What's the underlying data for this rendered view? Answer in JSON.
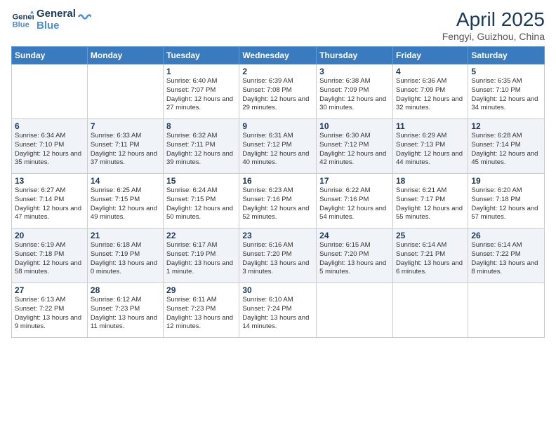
{
  "logo": {
    "line1": "General",
    "line2": "Blue"
  },
  "header": {
    "title": "April 2025",
    "subtitle": "Fengyi, Guizhou, China"
  },
  "days_of_week": [
    "Sunday",
    "Monday",
    "Tuesday",
    "Wednesday",
    "Thursday",
    "Friday",
    "Saturday"
  ],
  "weeks": [
    [
      {
        "day": "",
        "info": ""
      },
      {
        "day": "",
        "info": ""
      },
      {
        "day": "1",
        "info": "Sunrise: 6:40 AM\nSunset: 7:07 PM\nDaylight: 12 hours and 27 minutes."
      },
      {
        "day": "2",
        "info": "Sunrise: 6:39 AM\nSunset: 7:08 PM\nDaylight: 12 hours and 29 minutes."
      },
      {
        "day": "3",
        "info": "Sunrise: 6:38 AM\nSunset: 7:09 PM\nDaylight: 12 hours and 30 minutes."
      },
      {
        "day": "4",
        "info": "Sunrise: 6:36 AM\nSunset: 7:09 PM\nDaylight: 12 hours and 32 minutes."
      },
      {
        "day": "5",
        "info": "Sunrise: 6:35 AM\nSunset: 7:10 PM\nDaylight: 12 hours and 34 minutes."
      }
    ],
    [
      {
        "day": "6",
        "info": "Sunrise: 6:34 AM\nSunset: 7:10 PM\nDaylight: 12 hours and 35 minutes."
      },
      {
        "day": "7",
        "info": "Sunrise: 6:33 AM\nSunset: 7:11 PM\nDaylight: 12 hours and 37 minutes."
      },
      {
        "day": "8",
        "info": "Sunrise: 6:32 AM\nSunset: 7:11 PM\nDaylight: 12 hours and 39 minutes."
      },
      {
        "day": "9",
        "info": "Sunrise: 6:31 AM\nSunset: 7:12 PM\nDaylight: 12 hours and 40 minutes."
      },
      {
        "day": "10",
        "info": "Sunrise: 6:30 AM\nSunset: 7:12 PM\nDaylight: 12 hours and 42 minutes."
      },
      {
        "day": "11",
        "info": "Sunrise: 6:29 AM\nSunset: 7:13 PM\nDaylight: 12 hours and 44 minutes."
      },
      {
        "day": "12",
        "info": "Sunrise: 6:28 AM\nSunset: 7:14 PM\nDaylight: 12 hours and 45 minutes."
      }
    ],
    [
      {
        "day": "13",
        "info": "Sunrise: 6:27 AM\nSunset: 7:14 PM\nDaylight: 12 hours and 47 minutes."
      },
      {
        "day": "14",
        "info": "Sunrise: 6:25 AM\nSunset: 7:15 PM\nDaylight: 12 hours and 49 minutes."
      },
      {
        "day": "15",
        "info": "Sunrise: 6:24 AM\nSunset: 7:15 PM\nDaylight: 12 hours and 50 minutes."
      },
      {
        "day": "16",
        "info": "Sunrise: 6:23 AM\nSunset: 7:16 PM\nDaylight: 12 hours and 52 minutes."
      },
      {
        "day": "17",
        "info": "Sunrise: 6:22 AM\nSunset: 7:16 PM\nDaylight: 12 hours and 54 minutes."
      },
      {
        "day": "18",
        "info": "Sunrise: 6:21 AM\nSunset: 7:17 PM\nDaylight: 12 hours and 55 minutes."
      },
      {
        "day": "19",
        "info": "Sunrise: 6:20 AM\nSunset: 7:18 PM\nDaylight: 12 hours and 57 minutes."
      }
    ],
    [
      {
        "day": "20",
        "info": "Sunrise: 6:19 AM\nSunset: 7:18 PM\nDaylight: 12 hours and 58 minutes."
      },
      {
        "day": "21",
        "info": "Sunrise: 6:18 AM\nSunset: 7:19 PM\nDaylight: 13 hours and 0 minutes."
      },
      {
        "day": "22",
        "info": "Sunrise: 6:17 AM\nSunset: 7:19 PM\nDaylight: 13 hours and 1 minute."
      },
      {
        "day": "23",
        "info": "Sunrise: 6:16 AM\nSunset: 7:20 PM\nDaylight: 13 hours and 3 minutes."
      },
      {
        "day": "24",
        "info": "Sunrise: 6:15 AM\nSunset: 7:20 PM\nDaylight: 13 hours and 5 minutes."
      },
      {
        "day": "25",
        "info": "Sunrise: 6:14 AM\nSunset: 7:21 PM\nDaylight: 13 hours and 6 minutes."
      },
      {
        "day": "26",
        "info": "Sunrise: 6:14 AM\nSunset: 7:22 PM\nDaylight: 13 hours and 8 minutes."
      }
    ],
    [
      {
        "day": "27",
        "info": "Sunrise: 6:13 AM\nSunset: 7:22 PM\nDaylight: 13 hours and 9 minutes."
      },
      {
        "day": "28",
        "info": "Sunrise: 6:12 AM\nSunset: 7:23 PM\nDaylight: 13 hours and 11 minutes."
      },
      {
        "day": "29",
        "info": "Sunrise: 6:11 AM\nSunset: 7:23 PM\nDaylight: 13 hours and 12 minutes."
      },
      {
        "day": "30",
        "info": "Sunrise: 6:10 AM\nSunset: 7:24 PM\nDaylight: 13 hours and 14 minutes."
      },
      {
        "day": "",
        "info": ""
      },
      {
        "day": "",
        "info": ""
      },
      {
        "day": "",
        "info": ""
      }
    ]
  ]
}
